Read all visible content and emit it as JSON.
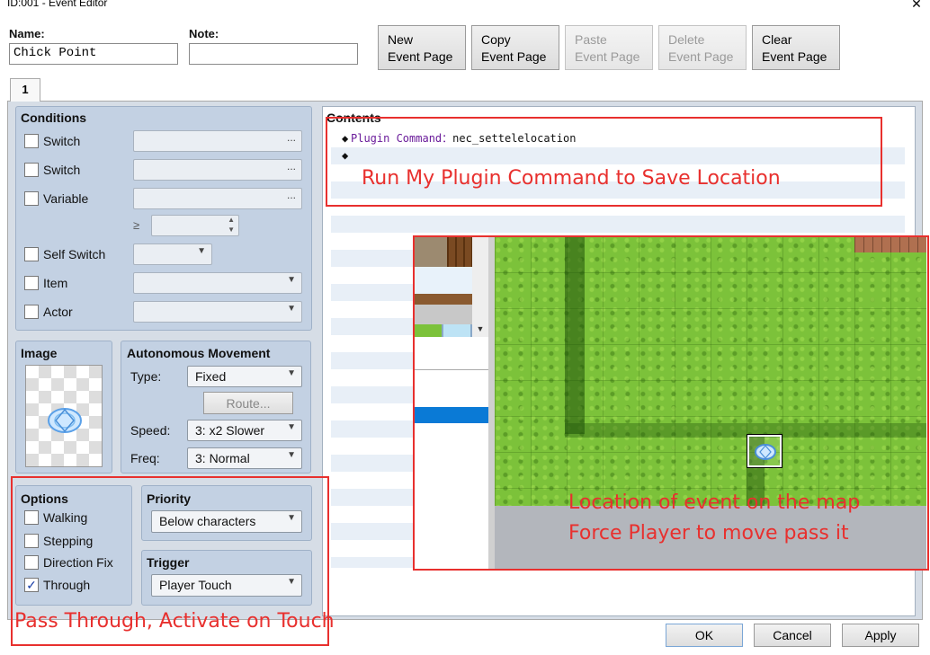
{
  "window": {
    "title": "ID:001 - Event Editor",
    "close_glyph": "✕"
  },
  "header": {
    "name_label": "Name:",
    "name_value": "Chick Point",
    "note_label": "Note:",
    "note_value": "",
    "buttons": {
      "new_l1": "New",
      "new_l2": "Event Page",
      "copy_l1": "Copy",
      "copy_l2": "Event Page",
      "paste_l1": "Paste",
      "paste_l2": "Event Page",
      "delete_l1": "Delete",
      "delete_l2": "Event Page",
      "clear_l1": "Clear",
      "clear_l2": "Event Page"
    }
  },
  "tabs": [
    "1"
  ],
  "conditions": {
    "title": "Conditions",
    "switch1": "Switch",
    "switch2": "Switch",
    "variable": "Variable",
    "ge_symbol": "≥",
    "self_switch": "Self Switch",
    "item": "Item",
    "actor": "Actor",
    "dots": "..."
  },
  "image": {
    "title": "Image",
    "icon": "magic-circle-icon"
  },
  "movement": {
    "title": "Autonomous Movement",
    "type_label": "Type:",
    "type_value": "Fixed",
    "route_button": "Route...",
    "speed_label": "Speed:",
    "speed_value": "3: x2 Slower",
    "freq_label": "Freq:",
    "freq_value": "3: Normal"
  },
  "options": {
    "title": "Options",
    "walking": {
      "label": "Walking",
      "checked": false
    },
    "stepping": {
      "label": "Stepping",
      "checked": false
    },
    "direction_fix": {
      "label": "Direction Fix",
      "checked": false
    },
    "through": {
      "label": "Through",
      "checked": true,
      "mark": "✓"
    }
  },
  "priority": {
    "title": "Priority",
    "value": "Below characters"
  },
  "trigger": {
    "title": "Trigger",
    "value": "Player Touch"
  },
  "contents": {
    "title": "Contents",
    "commands": [
      {
        "bullet": "◆",
        "keyword": "Plugin Command",
        "sep": "：",
        "value": "nec_settelelocation"
      },
      {
        "bullet": "◆",
        "keyword": "",
        "sep": "",
        "value": ""
      }
    ]
  },
  "annotations": {
    "plugin": "Run My Plugin Command to Save Location",
    "map_line1": "Location of event on the map",
    "map_line2": "Force Player to move pass it",
    "options": "Pass Through, Activate on Touch",
    "color": "#e8302e"
  },
  "footer": {
    "ok": "OK",
    "cancel": "Cancel",
    "apply": "Apply"
  },
  "colors": {
    "group_bg": "#c3d1e3",
    "selected_row": "#0a7ad6",
    "grass": "#7cc23a",
    "annotation_red": "#e8302e"
  }
}
